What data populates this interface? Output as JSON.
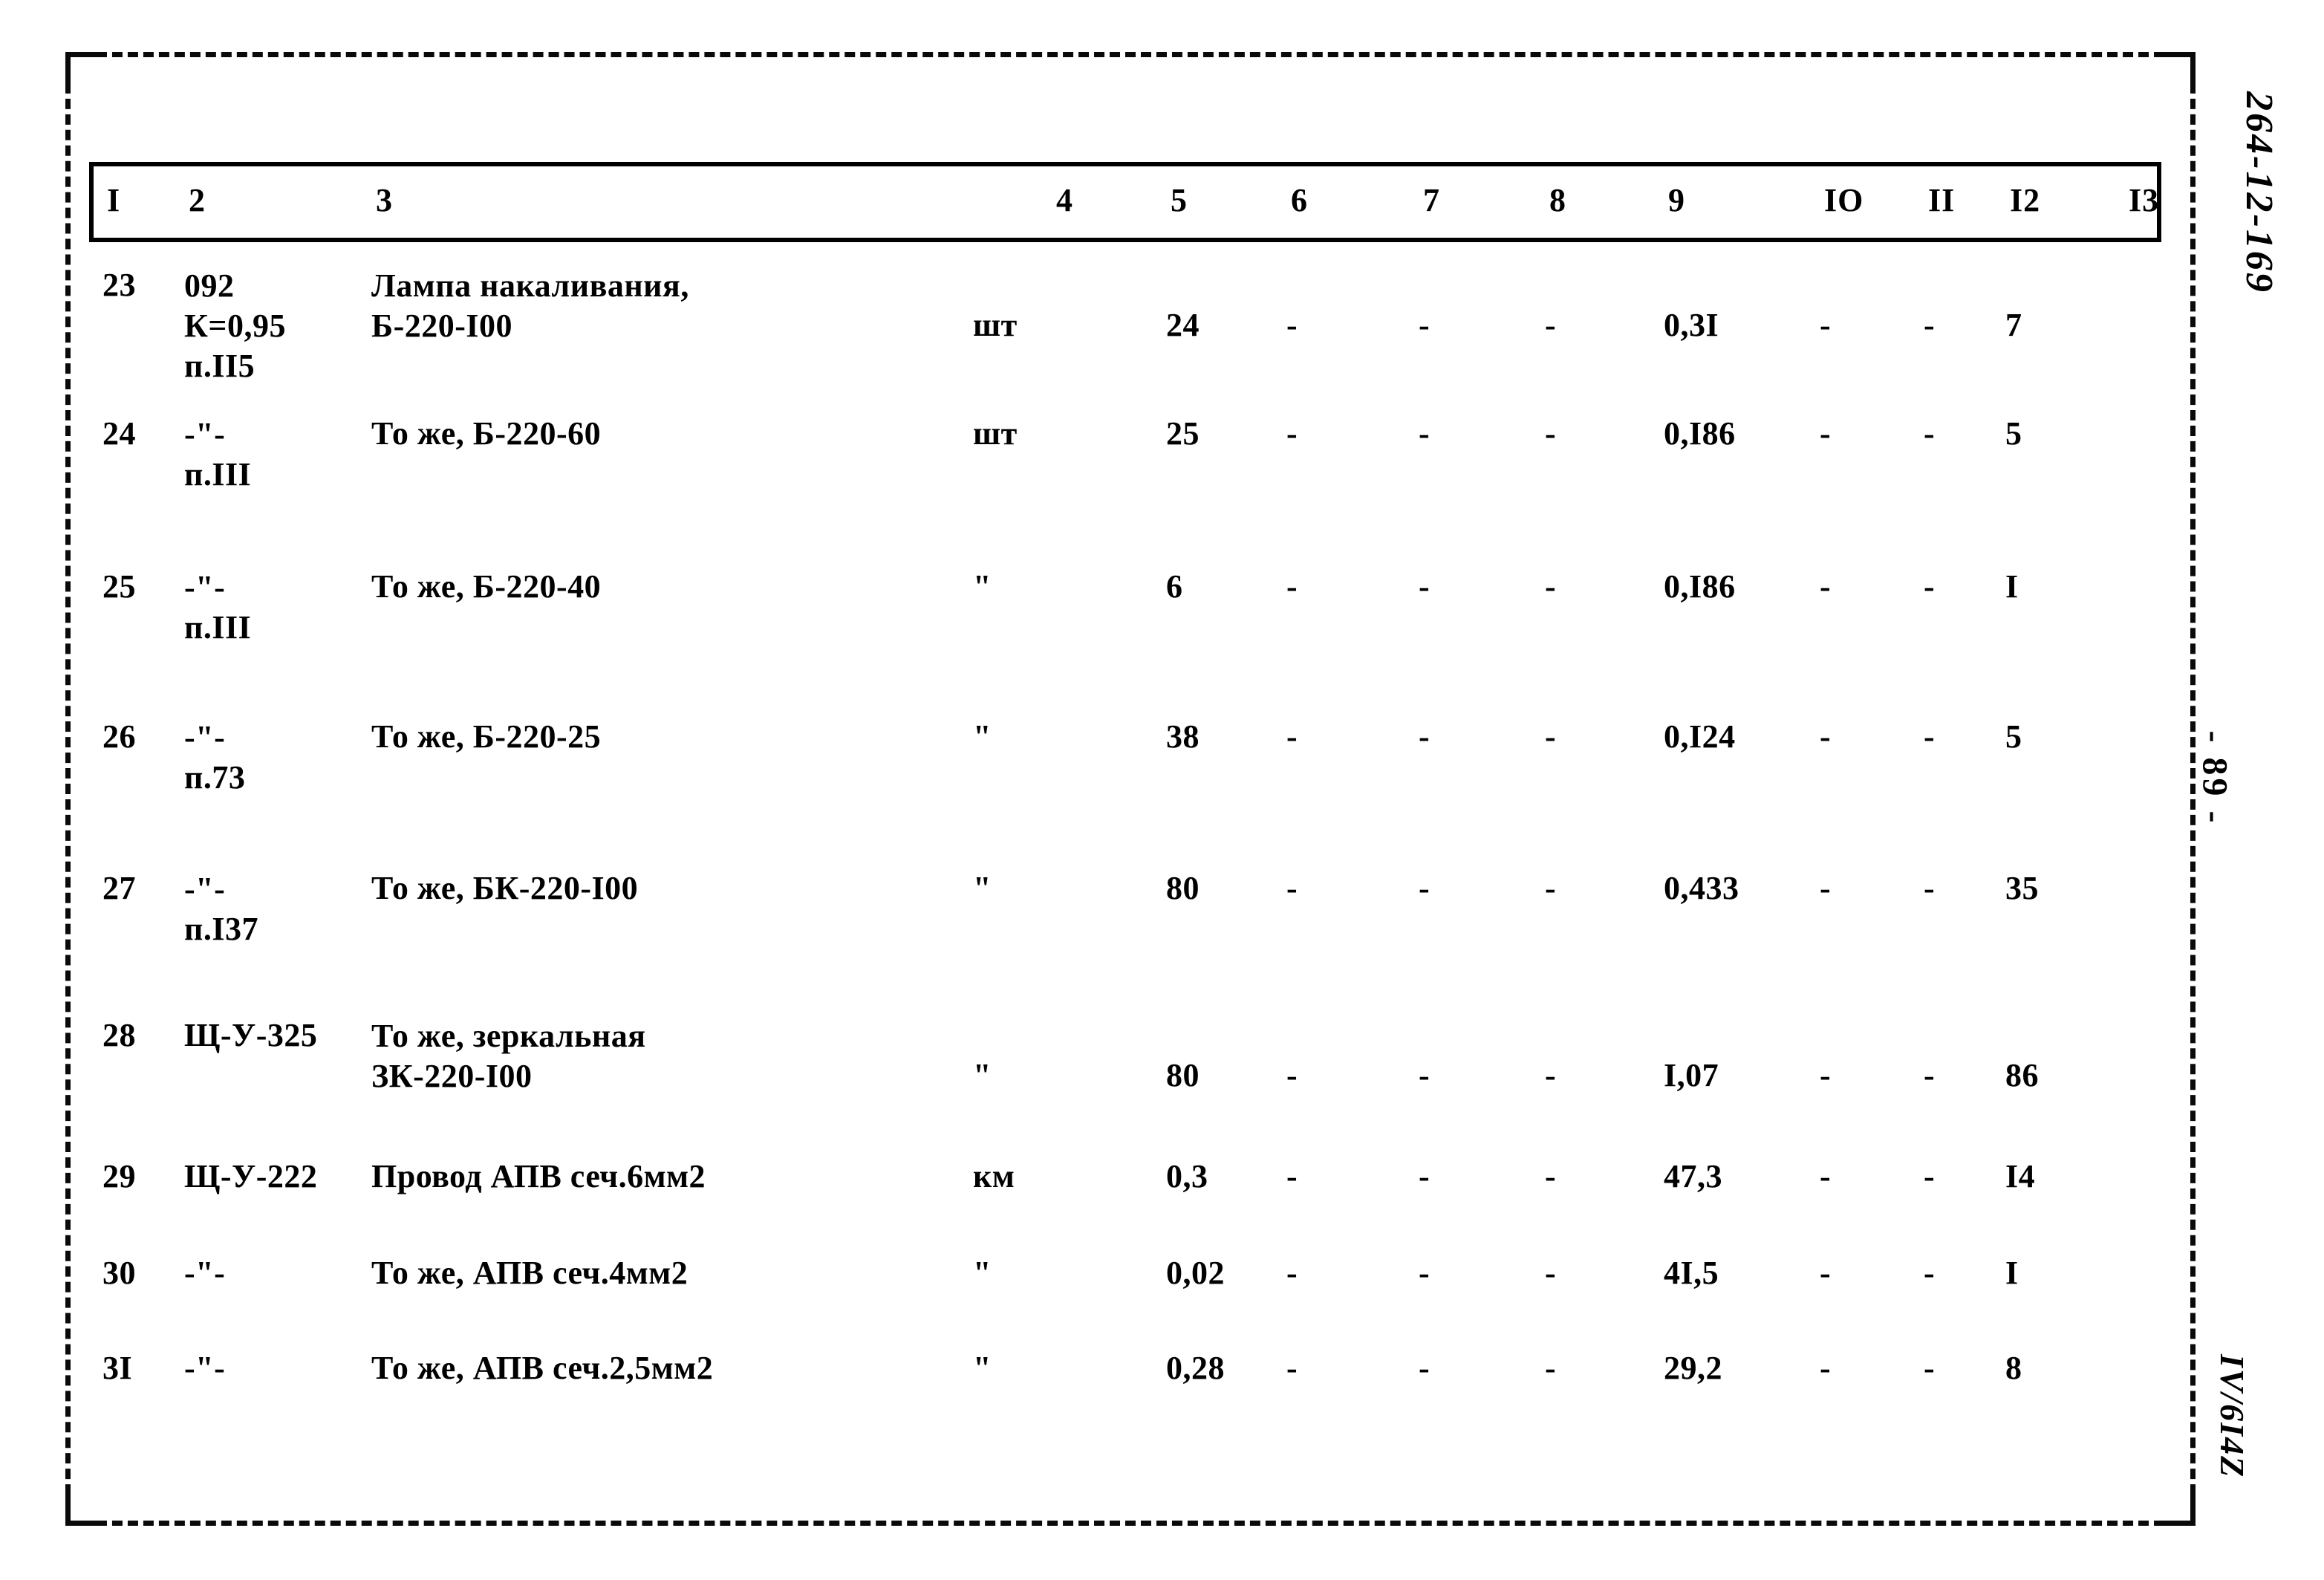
{
  "document": {
    "doc_number": "264-12-169",
    "page_number": "- 89 -",
    "section_mark": "IV/6I4Z"
  },
  "table": {
    "column_headers": [
      "I",
      "2",
      "3",
      "4",
      "5",
      "6",
      "7",
      "8",
      "9",
      "IO",
      "II",
      "I2",
      "I3"
    ],
    "rows": [
      {
        "no": "23",
        "code": "092\nК=0,95\nп.II5",
        "name": "Лампа накаливания,\nБ-220-I00",
        "unit": "шт",
        "c5": "24",
        "c6": "-",
        "c7": "-",
        "c8": "-",
        "c9": "0,3I",
        "c10": "-",
        "c11": "-",
        "c12": "7",
        "c13": ""
      },
      {
        "no": "24",
        "code": "-\"-\nп.III",
        "name": "То же, Б-220-60",
        "unit": "шт",
        "c5": "25",
        "c6": "-",
        "c7": "-",
        "c8": "-",
        "c9": "0,I86",
        "c10": "-",
        "c11": "-",
        "c12": "5",
        "c13": ""
      },
      {
        "no": "25",
        "code": "-\"-\nп.III",
        "name": "То же, Б-220-40",
        "unit": "\"",
        "c5": "6",
        "c6": "-",
        "c7": "-",
        "c8": "-",
        "c9": "0,I86",
        "c10": "-",
        "c11": "-",
        "c12": "I",
        "c13": ""
      },
      {
        "no": "26",
        "code": "-\"-\nп.73",
        "name": "То же, Б-220-25",
        "unit": "\"",
        "c5": "38",
        "c6": "-",
        "c7": "-",
        "c8": "-",
        "c9": "0,I24",
        "c10": "-",
        "c11": "-",
        "c12": "5",
        "c13": ""
      },
      {
        "no": "27",
        "code": "-\"-\nп.I37",
        "name": "То же, БК-220-I00",
        "unit": "\"",
        "c5": "80",
        "c6": "-",
        "c7": "-",
        "c8": "-",
        "c9": "0,433",
        "c10": "-",
        "c11": "-",
        "c12": "35",
        "c13": ""
      },
      {
        "no": "28",
        "code": "Щ-У-325",
        "name": "То же, зеркальная\nЗК-220-I00",
        "unit": "\"",
        "c5": "80",
        "c6": "-",
        "c7": "-",
        "c8": "-",
        "c9": "I,07",
        "c10": "-",
        "c11": "-",
        "c12": "86",
        "c13": ""
      },
      {
        "no": "29",
        "code": "Щ-У-222",
        "name": "Провод АПВ сеч.6мм2",
        "unit": "км",
        "c5": "0,3",
        "c6": "-",
        "c7": "-",
        "c8": "-",
        "c9": "47,3",
        "c10": "-",
        "c11": "-",
        "c12": "I4",
        "c13": ""
      },
      {
        "no": "30",
        "code": "-\"-",
        "name": "То же, АПВ сеч.4мм2",
        "unit": "\"",
        "c5": "0,02",
        "c6": "-",
        "c7": "-",
        "c8": "-",
        "c9": "4I,5",
        "c10": "-",
        "c11": "-",
        "c12": "I",
        "c13": ""
      },
      {
        "no": "3I",
        "code": "-\"-",
        "name": "То же, АПВ сеч.2,5мм2",
        "unit": "\"",
        "c5": "0,28",
        "c6": "-",
        "c7": "-",
        "c8": "-",
        "c9": "29,2",
        "c10": "-",
        "c11": "-",
        "c12": "8",
        "c13": ""
      }
    ]
  }
}
